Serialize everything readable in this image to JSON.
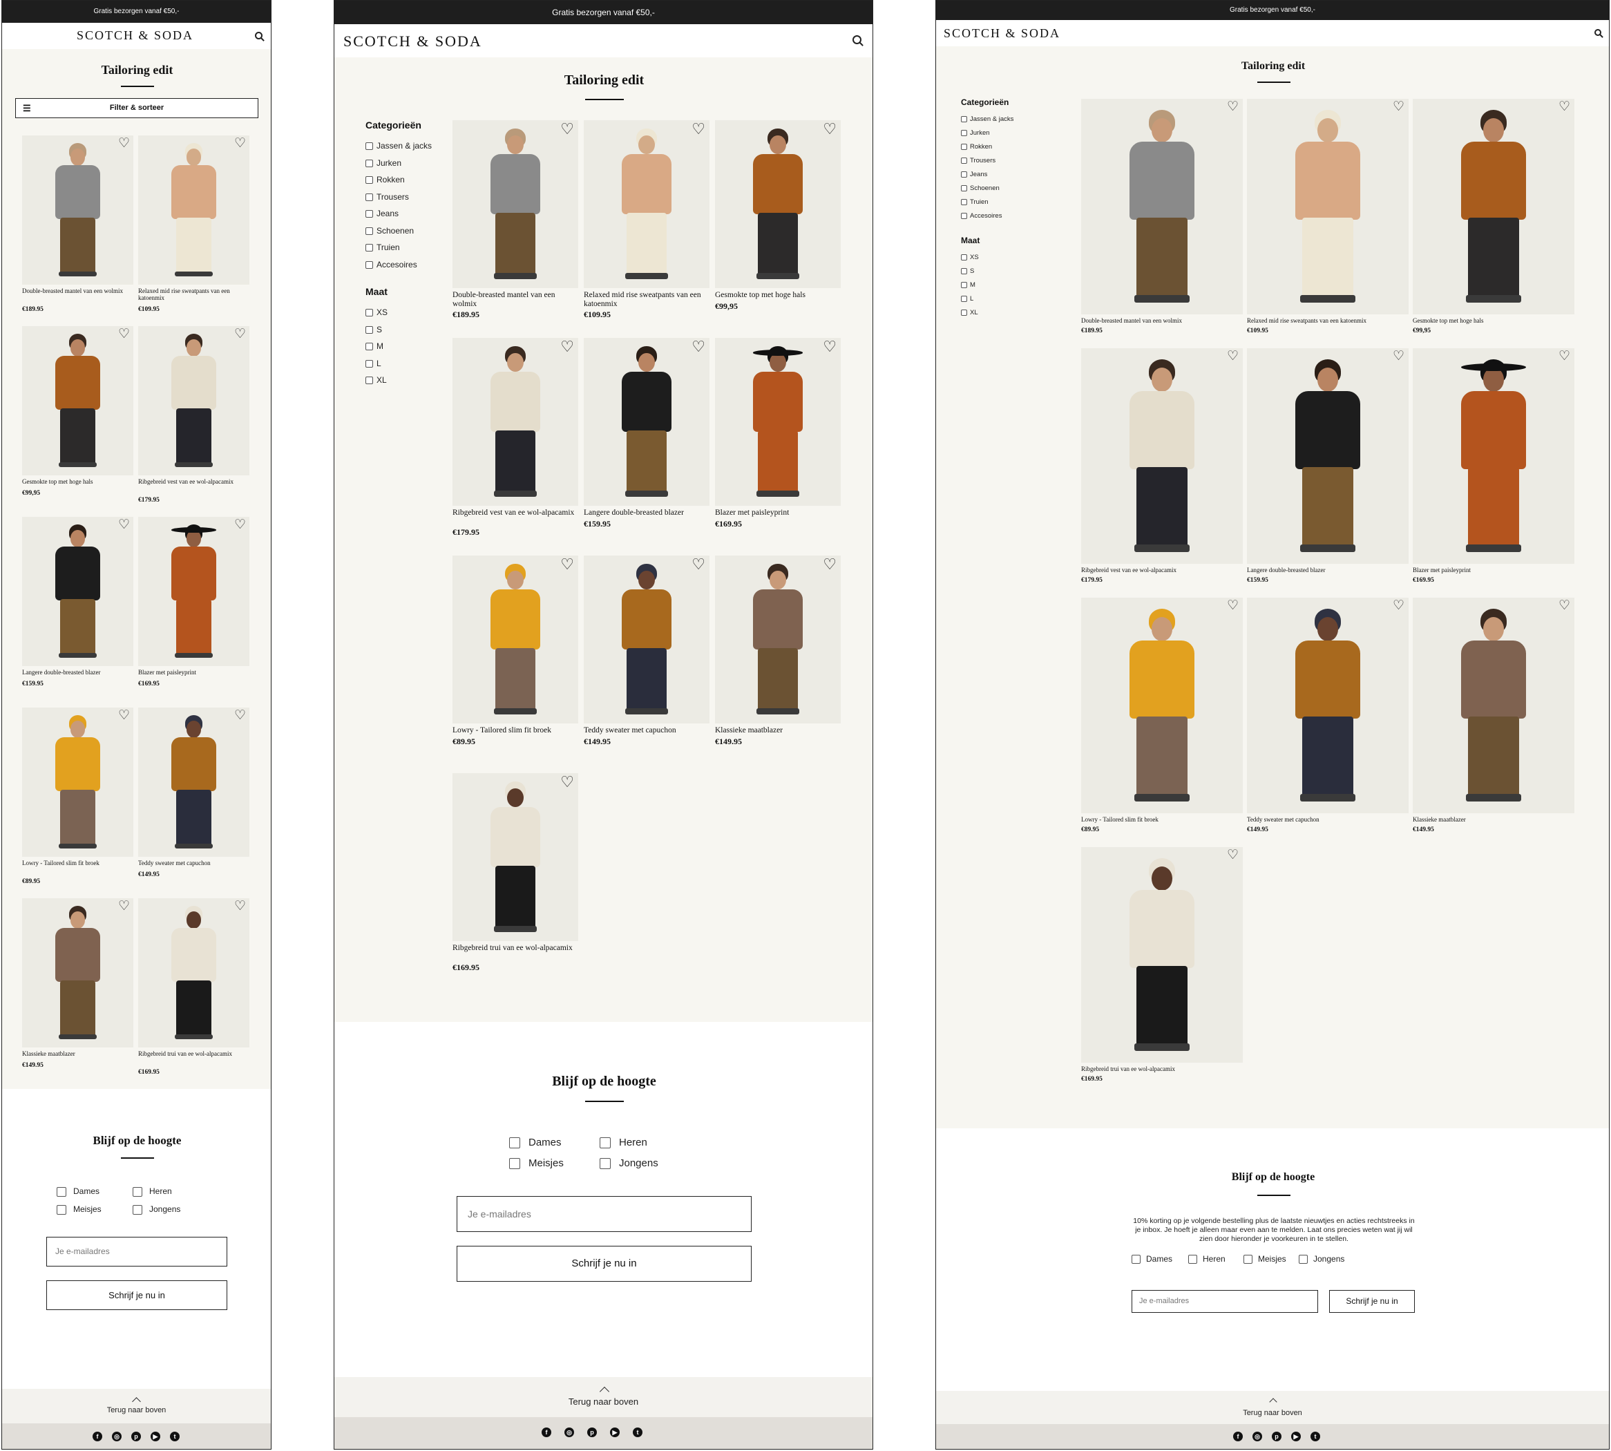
{
  "topbar": {
    "text": "Gratis bezorgen vanaf €50,-"
  },
  "logo": "SCOTCH & SODA",
  "icons": {
    "search": "search-icon",
    "heart": "heart-icon",
    "filter": "sliders-icon",
    "chevron": "chevron-up-icon"
  },
  "page": {
    "title": "Tailoring edit"
  },
  "mobile": {
    "filter_button": "Filter & sorteer"
  },
  "filters": {
    "categories_title": "Categorieën",
    "categories": [
      "Jassen & jacks",
      "Jurken",
      "Rokken",
      "Trousers",
      "Jeans",
      "Schoenen",
      "Truien",
      "Accesoires"
    ],
    "size_title": "Maat",
    "sizes": [
      "XS",
      "S",
      "M",
      "L",
      "XL"
    ]
  },
  "products": [
    {
      "name": "Double-breasted mantel van een wolmix",
      "price": "€189.95",
      "figure": "coat-check"
    },
    {
      "name": "Relaxed mid rise sweatpants van een katoenmix",
      "price": "€109.95",
      "figure": "cream-pants"
    },
    {
      "name": "Gesmokte top met hoge hals",
      "price": "€99,95",
      "figure": "rust-top"
    },
    {
      "name": "Ribgebreid vest van ee wol-alpacamix",
      "price": "€179.95",
      "figure": "cream-cardigan"
    },
    {
      "name": "Langere double-breasted blazer",
      "price": "€159.95",
      "figure": "black-blazer"
    },
    {
      "name": "Blazer met paisleyprint",
      "price": "€169.95",
      "figure": "rust-blazer-hat"
    },
    {
      "name": "Lowry - Tailored slim fit broek",
      "price": "€89.95",
      "figure": "check-pants"
    },
    {
      "name": "Teddy sweater met capuchon",
      "price": "€149.95",
      "figure": "teddy-hoodie"
    },
    {
      "name": "Klassieke maatblazer",
      "price": "€149.95",
      "figure": "check-blazer"
    },
    {
      "name": "Ribgebreid trui van ee wol-alpacamix",
      "price": "€169.95",
      "figure": "cream-sweater"
    }
  ],
  "newsletter": {
    "title": "Blijf op de hoogte",
    "description": "10% korting op je volgende bestelling plus de laatste nieuwtjes en acties rechtstreeks in je inbox. Je hoeft je alleen maar even aan te melden. Laat ons precies weten wat jij wil zien door hieronder je voorkeuren in te stellen.",
    "options": [
      "Dames",
      "Heren",
      "Meisjes",
      "Jongens"
    ],
    "email_placeholder": "Je e-mailadres",
    "submit_label": "Schrijf je nu in"
  },
  "back_to_top": "Terug naar boven",
  "social": [
    {
      "icon": "facebook-icon",
      "glyph": "f"
    },
    {
      "icon": "instagram-icon",
      "glyph": "◎"
    },
    {
      "icon": "pinterest-icon",
      "glyph": "p"
    },
    {
      "icon": "youtube-icon",
      "glyph": "▶"
    },
    {
      "icon": "twitter-icon",
      "glyph": "t"
    }
  ],
  "figure_colors": {
    "coat-check": {
      "top": "#8a8a8a",
      "bottom": "#6b5233",
      "skin": "#c89a78",
      "hair": "#b99a7a"
    },
    "cream-pants": {
      "top": "#d9a985",
      "bottom": "#ede6d3",
      "skin": "#d3ab88",
      "hair": "#ede6d3"
    },
    "rust-top": {
      "top": "#a85c1d",
      "bottom": "#2c2a2a",
      "skin": "#b98462",
      "hair": "#3a2a20"
    },
    "cream-cardigan": {
      "top": "#e4ddcc",
      "bottom": "#25252b",
      "skin": "#c89a78",
      "hair": "#3a2a20"
    },
    "black-blazer": {
      "top": "#1d1d1d",
      "bottom": "#7a5a30",
      "skin": "#b98462",
      "hair": "#2a1e16"
    },
    "rust-blazer-hat": {
      "top": "#b4541e",
      "bottom": "#b4541e",
      "skin": "#8f5e42",
      "hair": "#111111"
    },
    "check-pants": {
      "top": "#e2a11f",
      "bottom": "#7b6353",
      "skin": "#c89a78",
      "hair": "#e2a11f"
    },
    "teddy-hoodie": {
      "top": "#a8691e",
      "bottom": "#2a2d3c",
      "skin": "#6a4330",
      "hair": "#2f3242"
    },
    "check-blazer": {
      "top": "#7f6250",
      "bottom": "#6b5233",
      "skin": "#c89a78",
      "hair": "#3a2a20"
    },
    "cream-sweater": {
      "top": "#e8e2d4",
      "bottom": "#1a1a1a",
      "skin": "#5a3a2a",
      "hair": "#e8e2d4"
    }
  }
}
